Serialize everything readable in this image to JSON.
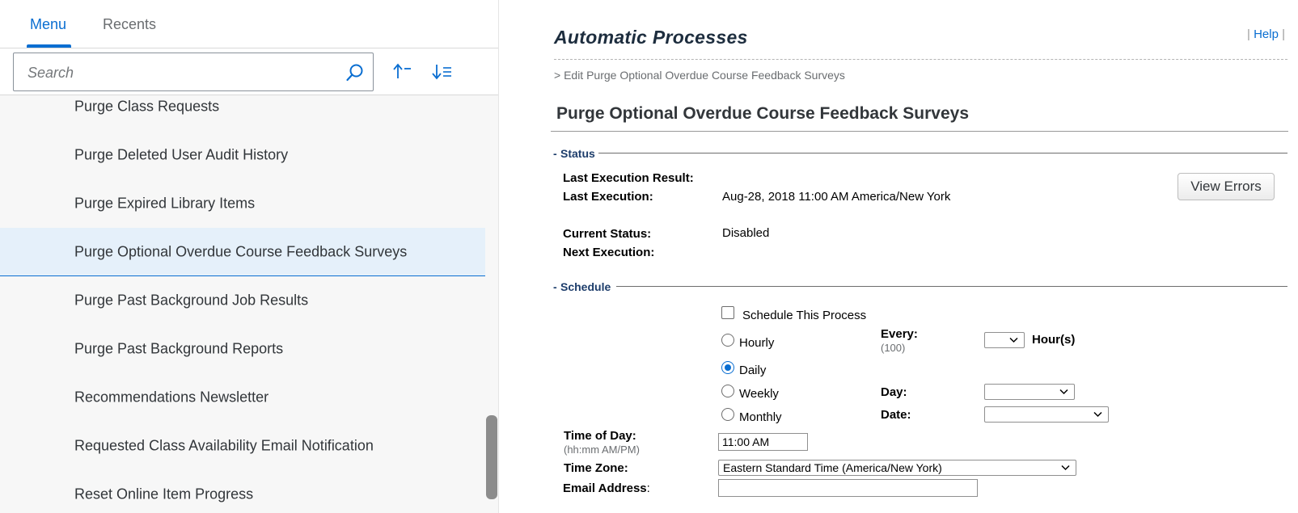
{
  "tabs": {
    "menu": "Menu",
    "recents": "Recents"
  },
  "search": {
    "placeholder": "Search"
  },
  "nav": {
    "items": [
      {
        "label": "Purge Class Requests"
      },
      {
        "label": "Purge Deleted User Audit History"
      },
      {
        "label": "Purge Expired Library Items"
      },
      {
        "label": "Purge Optional Overdue Course Feedback Surveys",
        "selected": true
      },
      {
        "label": "Purge Past Background Job Results"
      },
      {
        "label": "Purge Past Background Reports"
      },
      {
        "label": "Recommendations Newsletter"
      },
      {
        "label": "Requested Class Availability Email Notification"
      },
      {
        "label": "Reset Online Item Progress"
      }
    ]
  },
  "header": {
    "title": "Automatic Processes",
    "help_separator_left": "|",
    "help": "Help",
    "help_separator_right": "|",
    "breadcrumb": "> Edit Purge Optional Overdue Course Feedback Surveys",
    "page_heading": "Purge Optional Overdue Course Feedback Surveys"
  },
  "status_section": {
    "legend_prefix": "-",
    "legend": "Status",
    "last_execution_result_label": "Last Execution Result:",
    "last_execution_label": "Last Execution:",
    "last_execution_value": "Aug-28, 2018 11:00 AM America/New York",
    "current_status_label": "Current Status:",
    "current_status_value": "Disabled",
    "next_execution_label": "Next Execution:",
    "view_errors_button": "View Errors"
  },
  "schedule_section": {
    "legend_prefix": "-",
    "legend": "Schedule",
    "schedule_checkbox_label": "Schedule This Process",
    "schedule_checked": false,
    "frequency_options": [
      {
        "label": "Hourly",
        "selected": false
      },
      {
        "label": "Daily",
        "selected": true
      },
      {
        "label": "Weekly",
        "selected": false
      },
      {
        "label": "Monthly",
        "selected": false
      }
    ],
    "every_label": "Every:",
    "every_hint": "(100)",
    "every_value": "",
    "hours_label": "Hour(s)",
    "day_label": "Day:",
    "day_value": "",
    "date_label": "Date:",
    "date_value": "",
    "time_of_day_label": "Time of Day:",
    "time_of_day_hint": "(hh:mm AM/PM)",
    "time_of_day_value": "11:00 AM",
    "time_zone_label": "Time Zone:",
    "time_zone_value": "Eastern Standard Time (America/New York)",
    "email_label": "Email Address",
    "email_colon": ":",
    "email_value": ""
  },
  "colors": {
    "accent": "#0a6ed1",
    "selected_bg": "#e5f0fa",
    "legend": "#1d3d6b"
  },
  "icons": {
    "search": "search-icon",
    "sort_asc": "sort-ascending-icon",
    "sort_desc": "sort-descending-icon",
    "dropdown": "chevron-down-icon"
  }
}
